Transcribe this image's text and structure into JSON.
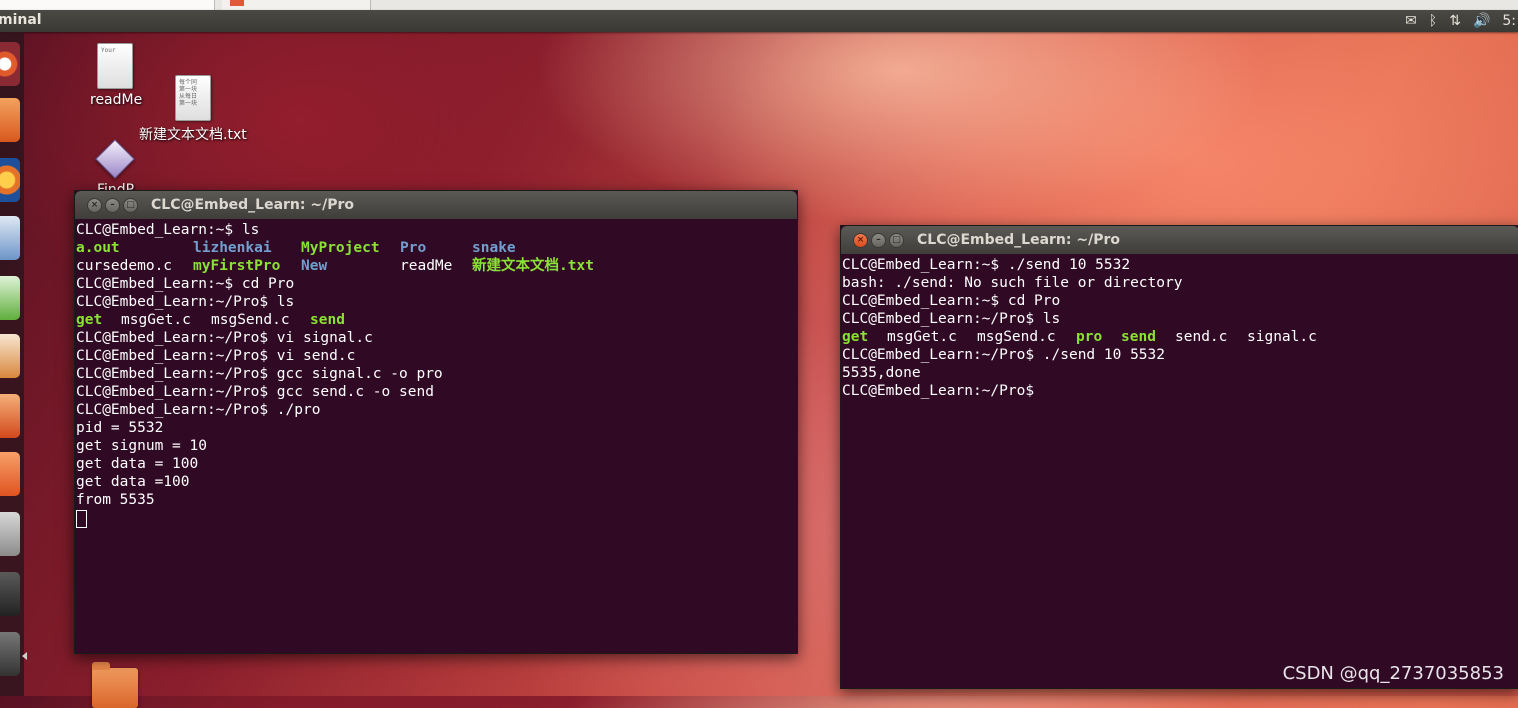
{
  "top_panel": {
    "title": "minal",
    "indicators": {
      "mail": "✉",
      "bluetooth": "ᛒ",
      "network": "⇅",
      "volume": "🔊",
      "clock": "5:"
    }
  },
  "launcher": {
    "items": [
      "ubuntu-dash",
      "files",
      "firefox",
      "libreoffice-writer",
      "libreoffice-calc",
      "libreoffice-impress",
      "ubuntu-software",
      "ubuntu-one",
      "system-settings",
      "terminal",
      "workspace-switcher"
    ]
  },
  "desktop": {
    "icons": [
      {
        "label": "readMe",
        "preview": "Your"
      },
      {
        "label": "新建文本文档.txt",
        "preview": "每个同\n第一块\n从每日\n第一块"
      },
      {
        "label": "FindP"
      }
    ]
  },
  "terminal_left": {
    "title": "CLC@Embed_Learn: ~/Pro",
    "lines": [
      {
        "text": "CLC@Embed_Learn:~$ ls"
      },
      {
        "ls": [
          {
            "text": "a.out",
            "kind": "exe",
            "w": 13
          },
          {
            "text": "lizhenkai",
            "kind": "dir",
            "w": 12
          },
          {
            "text": "MyProject",
            "kind": "exe",
            "w": 11
          },
          {
            "text": "Pro",
            "kind": "dir",
            "w": 8
          },
          {
            "text": "snake",
            "kind": "dir",
            "w": 0
          }
        ]
      },
      {
        "ls": [
          {
            "text": "cursedemo.c",
            "kind": "plain",
            "w": 13
          },
          {
            "text": "myFirstPro",
            "kind": "exe",
            "w": 12
          },
          {
            "text": "New",
            "kind": "dir",
            "w": 11
          },
          {
            "text": "readMe",
            "kind": "plain",
            "w": 8
          },
          {
            "text": "新建文本文档.txt",
            "kind": "exe",
            "w": 0
          }
        ]
      },
      {
        "text": "CLC@Embed_Learn:~$ cd Pro"
      },
      {
        "text": "CLC@Embed_Learn:~/Pro$ ls"
      },
      {
        "ls": [
          {
            "text": "get",
            "kind": "exe",
            "w": 5
          },
          {
            "text": "msgGet.c",
            "kind": "plain",
            "w": 10
          },
          {
            "text": "msgSend.c",
            "kind": "plain",
            "w": 11
          },
          {
            "text": "send",
            "kind": "exe",
            "w": 0
          }
        ]
      },
      {
        "text": "CLC@Embed_Learn:~/Pro$ vi signal.c"
      },
      {
        "text": "CLC@Embed_Learn:~/Pro$ vi send.c"
      },
      {
        "text": "CLC@Embed_Learn:~/Pro$ gcc signal.c -o pro"
      },
      {
        "text": "CLC@Embed_Learn:~/Pro$ gcc send.c -o send"
      },
      {
        "text": "CLC@Embed_Learn:~/Pro$ ./pro"
      },
      {
        "text": "pid = 5532"
      },
      {
        "text": "get signum = 10"
      },
      {
        "text": "get data = 100"
      },
      {
        "text": "get data =100"
      },
      {
        "text": "from 5535"
      },
      {
        "cursor": true
      }
    ]
  },
  "terminal_right": {
    "title": "CLC@Embed_Learn: ~/Pro",
    "lines": [
      {
        "text": "CLC@Embed_Learn:~$ ./send 10 5532"
      },
      {
        "text": "bash: ./send: No such file or directory"
      },
      {
        "text": "CLC@Embed_Learn:~$ cd Pro"
      },
      {
        "text": "CLC@Embed_Learn:~/Pro$ ls"
      },
      {
        "ls": [
          {
            "text": "get",
            "kind": "exe",
            "w": 5
          },
          {
            "text": "msgGet.c",
            "kind": "plain",
            "w": 10
          },
          {
            "text": "msgSend.c",
            "kind": "plain",
            "w": 11
          },
          {
            "text": "pro",
            "kind": "exe",
            "w": 5
          },
          {
            "text": "send",
            "kind": "exe",
            "w": 6
          },
          {
            "text": "send.c",
            "kind": "plain",
            "w": 8
          },
          {
            "text": "signal.c",
            "kind": "plain",
            "w": 0
          }
        ]
      },
      {
        "text": "CLC@Embed_Learn:~/Pro$ ./send 10 5532"
      },
      {
        "text": "5535,done"
      },
      {
        "text": "CLC@Embed_Learn:~/Pro$"
      }
    ]
  },
  "watermark": "CSDN @qq_2737035853",
  "colors": {
    "terminal_bg": "#300a24",
    "exe": "#8ae234",
    "dir": "#729fcf",
    "close_button": "#e05a2b"
  }
}
